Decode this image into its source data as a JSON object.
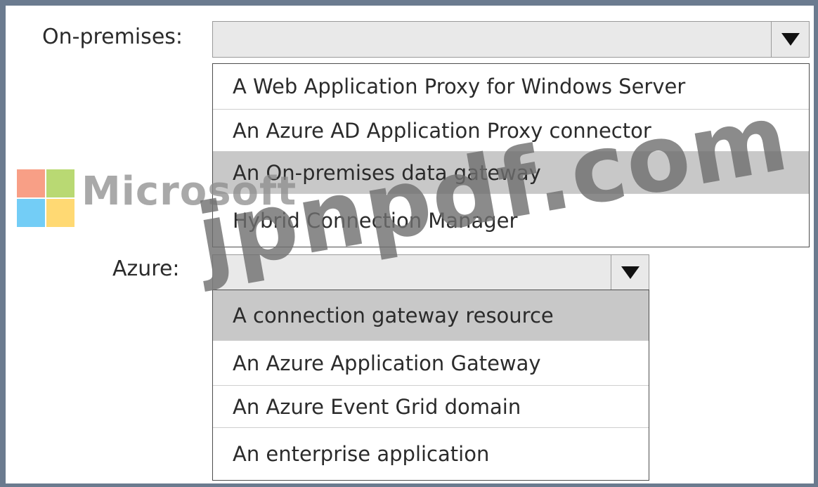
{
  "onprem": {
    "label": "On-premises:",
    "options": [
      {
        "label": "A Web Application Proxy for Windows Server",
        "selected": false
      },
      {
        "label": "An Azure AD Application Proxy connector",
        "selected": false
      },
      {
        "label": "An On-premises data gateway",
        "selected": true
      },
      {
        "label": "Hybrid Connection Manager",
        "selected": false
      }
    ]
  },
  "azure": {
    "label": "Azure:",
    "options": [
      {
        "label": "A connection gateway resource",
        "selected": true
      },
      {
        "label": "An Azure Application Gateway",
        "selected": false
      },
      {
        "label": "An Azure Event Grid domain",
        "selected": false
      },
      {
        "label": "An enterprise application",
        "selected": false
      }
    ]
  },
  "watermark": {
    "brand": "Microsoft",
    "site": "jpnpdf.com",
    "logo_colors": [
      "#f25022",
      "#7fba00",
      "#00a4ef",
      "#ffb900"
    ]
  }
}
